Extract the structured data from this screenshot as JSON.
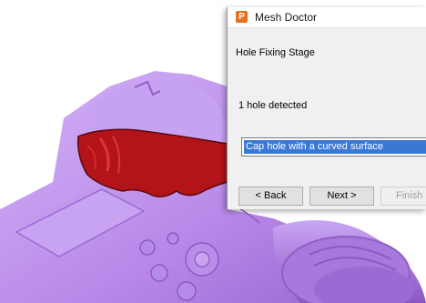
{
  "window": {
    "title": "Mesh Doctor",
    "app_icon_glyph": "P"
  },
  "dialog": {
    "stage_title": "Hole Fixing Stage",
    "status": "1 hole detected",
    "fill_method_selected": "Cap hole with a curved surface"
  },
  "buttons": {
    "back": "< Back",
    "next": "Next >",
    "finish": "Finish"
  },
  "colors": {
    "mesh": "#c49bf2",
    "hole_highlight": "#c01818",
    "selection": "#3a78d6",
    "app_icon": "#e2731f"
  }
}
